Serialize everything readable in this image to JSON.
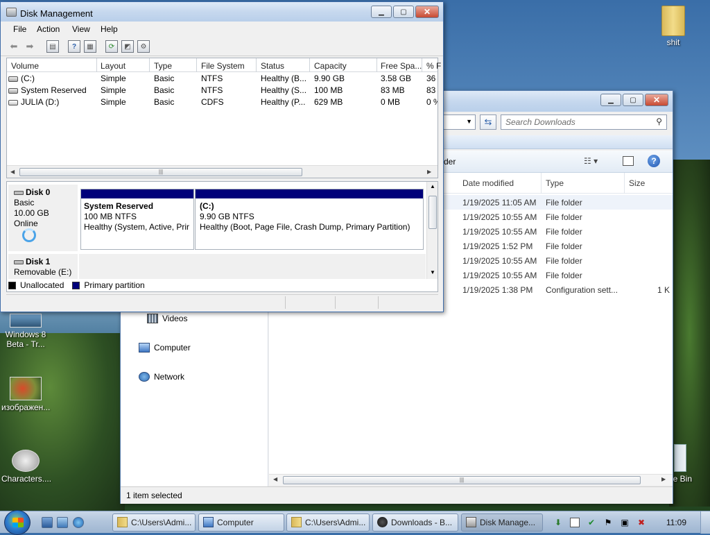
{
  "desktop": {
    "icons": [
      {
        "label": "shit"
      },
      {
        "label": "Windows 8 Beta - Tr..."
      },
      {
        "label": "изображен..."
      },
      {
        "label": "Characters...."
      },
      {
        "label": "cle Bin"
      }
    ]
  },
  "disk_management": {
    "title": "Disk Management",
    "menu": [
      "File",
      "Action",
      "View",
      "Help"
    ],
    "columns": [
      "Volume",
      "Layout",
      "Type",
      "File System",
      "Status",
      "Capacity",
      "Free Spa...",
      "% F"
    ],
    "volumes": [
      {
        "volume": "(C:)",
        "layout": "Simple",
        "type": "Basic",
        "fs": "NTFS",
        "status": "Healthy (B...",
        "capacity": "9.90 GB",
        "free": "3.58 GB",
        "pct": "36"
      },
      {
        "volume": "System Reserved",
        "layout": "Simple",
        "type": "Basic",
        "fs": "NTFS",
        "status": "Healthy (S...",
        "capacity": "100 MB",
        "free": "83 MB",
        "pct": "83"
      },
      {
        "volume": "JULIA (D:)",
        "layout": "Simple",
        "type": "Basic",
        "fs": "CDFS",
        "status": "Healthy (P...",
        "capacity": "629 MB",
        "free": "0 MB",
        "pct": "0 %"
      }
    ],
    "disks": [
      {
        "name": "Disk 0",
        "kind": "Basic",
        "size": "10.00 GB",
        "state": "Online"
      },
      {
        "name": "Disk 1",
        "kind": "Removable (E:)"
      }
    ],
    "partitions": [
      {
        "name": "System Reserved",
        "size": "100 MB NTFS",
        "status": "Healthy (System, Active, Prir"
      },
      {
        "name": "(C:)",
        "size": "9.90 GB NTFS",
        "status": "Healthy (Boot, Page File, Crash Dump, Primary Partition)"
      }
    ],
    "legend": {
      "unallocated": "Unallocated",
      "primary": "Primary partition"
    },
    "colors": {
      "primary": "#00007a",
      "unallocated": "#000000"
    }
  },
  "explorer": {
    "search_placeholder": "Search Downloads",
    "cmd_left": "der",
    "columns": {
      "date": "Date modified",
      "type": "Type",
      "size": "Size"
    },
    "files": [
      {
        "date": "1/19/2025 11:05 AM",
        "type": "File folder",
        "size": ""
      },
      {
        "date": "1/19/2025 10:55 AM",
        "type": "File folder",
        "size": ""
      },
      {
        "date": "1/19/2025 10:55 AM",
        "type": "File folder",
        "size": ""
      },
      {
        "date": "1/19/2025 1:52 PM",
        "type": "File folder",
        "size": ""
      },
      {
        "date": "1/19/2025 10:55 AM",
        "type": "File folder",
        "size": ""
      },
      {
        "date": "1/19/2025 10:55 AM",
        "type": "File folder",
        "size": ""
      },
      {
        "date": "1/19/2025 1:38 PM",
        "type": "Configuration sett...",
        "size": "1 K"
      }
    ],
    "nav": {
      "videos": "Videos",
      "computer": "Computer",
      "network": "Network"
    },
    "status": "1 item selected"
  },
  "taskbar": {
    "buttons": [
      {
        "label": "C:\\Users\\Admi...",
        "icon": "folder-icon"
      },
      {
        "label": "Computer",
        "icon": "computer-icon"
      },
      {
        "label": "C:\\Users\\Admi...",
        "icon": "folder-icon"
      },
      {
        "label": "Downloads - B...",
        "icon": "browser-icon"
      },
      {
        "label": "Disk Manage...",
        "icon": "disk-icon"
      }
    ],
    "clock": "11:09"
  }
}
